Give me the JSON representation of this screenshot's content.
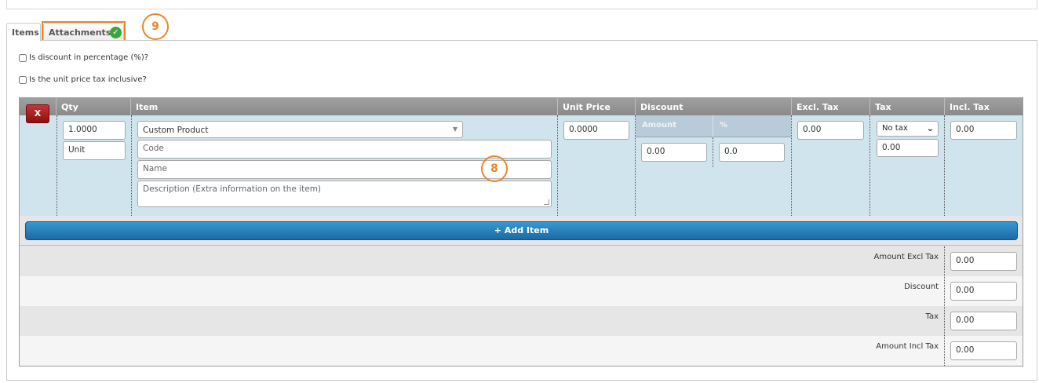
{
  "tabs": [
    {
      "label": "Items"
    },
    {
      "label": "Attachments"
    }
  ],
  "badges": {
    "nine": "9",
    "eight": "8"
  },
  "options": {
    "discount_percentage": "Is discount in percentage (%)?",
    "tax_inclusive": "Is the unit price tax inclusive?"
  },
  "table": {
    "headers": {
      "qty": "Qty",
      "item": "Item",
      "unit_price": "Unit Price",
      "discount": "Discount",
      "excl_tax": "Excl. Tax",
      "tax": "Tax",
      "incl_tax": "Incl. Tax"
    },
    "discount_sub": {
      "amount": "Amount",
      "percent": "%"
    },
    "row": {
      "delete_label": "X",
      "qty": "1.0000",
      "unit": "Unit",
      "product": "Custom Product",
      "code_placeholder": "Code",
      "name_placeholder": "Name",
      "description_placeholder": "Description (Extra information on the item)",
      "unit_price": "0.0000",
      "discount_amount": "0.00",
      "discount_percent": "0.0",
      "excl_tax": "0.00",
      "tax_option": "No tax",
      "tax_value": "0.00",
      "incl_tax": "0.00"
    },
    "add_item_label": "+ Add Item"
  },
  "totals": [
    {
      "label": "Amount Excl Tax",
      "value": "0.00"
    },
    {
      "label": "Discount",
      "value": "0.00"
    },
    {
      "label": "Tax",
      "value": "0.00"
    },
    {
      "label": "Amount Incl Tax",
      "value": "0.00"
    }
  ],
  "colors": {
    "highlight": "#e8872a",
    "check": "#39a53a",
    "row_bg": "#d0e4ee",
    "add_button": "#2a82bf",
    "delete_button": "#b02020"
  }
}
